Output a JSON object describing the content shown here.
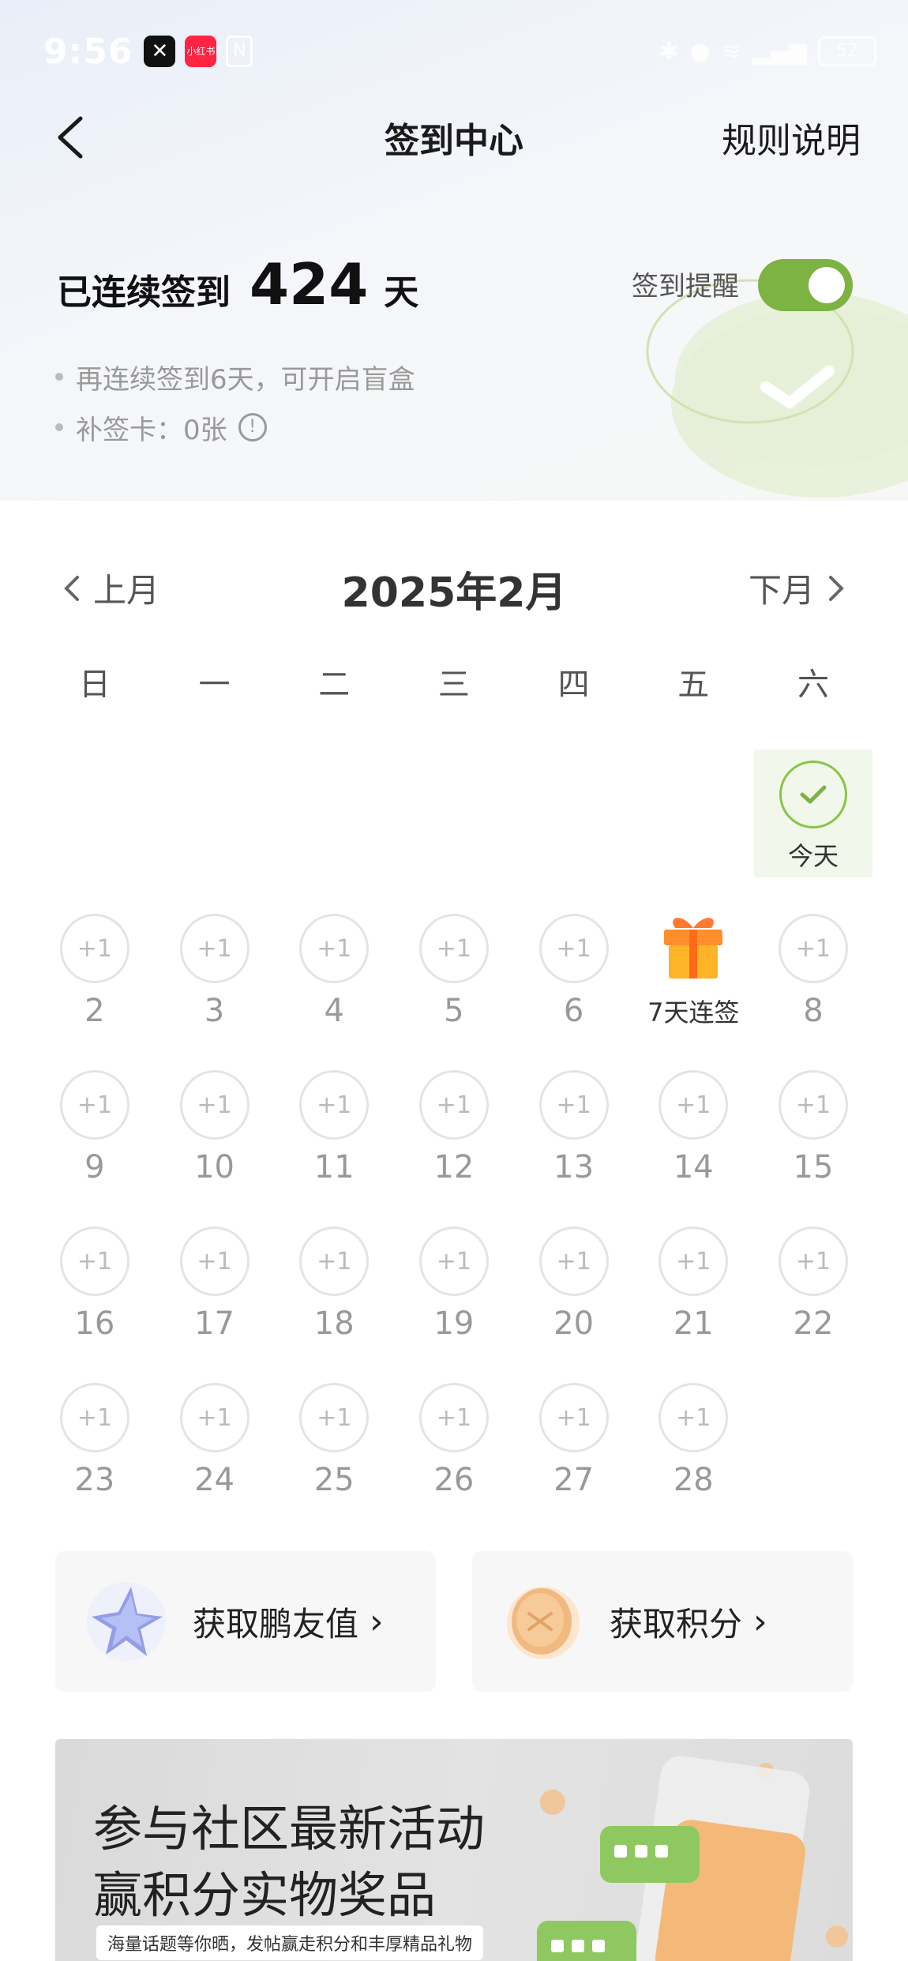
{
  "status_bar": {
    "time": "9:56",
    "battery": "52"
  },
  "header": {
    "title": "签到中心",
    "rules_label": "规则说明"
  },
  "streak": {
    "label": "已连续签到",
    "days": "424",
    "unit": "天"
  },
  "reminder": {
    "label": "签到提醒",
    "enabled": true
  },
  "bullets": [
    "再连续签到6天，可开启盲盒",
    "补签卡：0张"
  ],
  "calendar": {
    "prev_label": "上月",
    "next_label": "下月",
    "title": "2025年2月",
    "weekdays": [
      "日",
      "一",
      "二",
      "三",
      "四",
      "五",
      "六"
    ],
    "today_label": "今天",
    "reward_label": "+1",
    "gift_label": "7天连签",
    "days": [
      [
        "2",
        "3",
        "4",
        "5",
        "6",
        "",
        "8"
      ],
      [
        "9",
        "10",
        "11",
        "12",
        "13",
        "14",
        "15"
      ],
      [
        "16",
        "17",
        "18",
        "19",
        "20",
        "21",
        "22"
      ],
      [
        "23",
        "24",
        "25",
        "26",
        "27",
        "28"
      ]
    ]
  },
  "cards": [
    {
      "label": "获取鹏友值",
      "icon": "star-icon"
    },
    {
      "label": "获取积分",
      "icon": "coin-icon"
    }
  ],
  "banner": {
    "line1": "参与社区最新活动",
    "line2": "赢积分实物奖品",
    "sub": "海量话题等你晒，发帖赢走积分和丰厚精品礼物"
  },
  "colors": {
    "accent": "#7cb342",
    "today_bg": "#f1f7ea"
  }
}
